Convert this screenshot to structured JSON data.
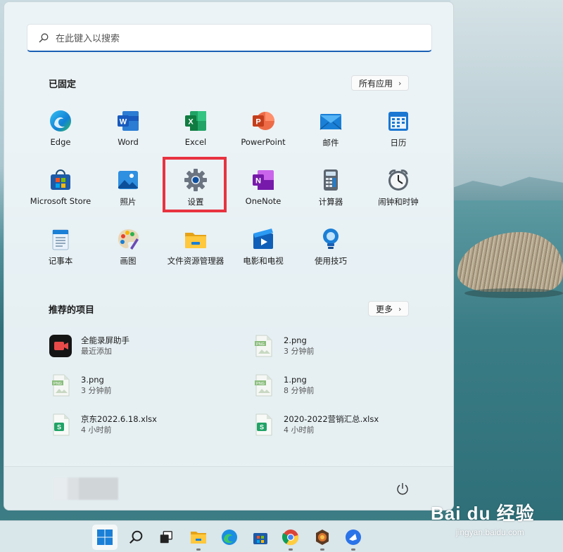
{
  "search": {
    "placeholder": "在此键入以搜索"
  },
  "pinned": {
    "title": "已固定",
    "all_apps_label": "所有应用",
    "apps": [
      {
        "label": "Edge",
        "icon": "edge-icon"
      },
      {
        "label": "Word",
        "icon": "word-icon"
      },
      {
        "label": "Excel",
        "icon": "excel-icon"
      },
      {
        "label": "PowerPoint",
        "icon": "powerpoint-icon"
      },
      {
        "label": "邮件",
        "icon": "mail-icon"
      },
      {
        "label": "日历",
        "icon": "calendar-icon"
      },
      {
        "label": "Microsoft Store",
        "icon": "store-icon"
      },
      {
        "label": "照片",
        "icon": "photos-icon"
      },
      {
        "label": "设置",
        "icon": "settings-gear-icon"
      },
      {
        "label": "OneNote",
        "icon": "onenote-icon"
      },
      {
        "label": "计算器",
        "icon": "calculator-icon"
      },
      {
        "label": "闹钟和时钟",
        "icon": "alarm-clock-icon"
      },
      {
        "label": "记事本",
        "icon": "notepad-icon"
      },
      {
        "label": "画图",
        "icon": "paint-palette-icon"
      },
      {
        "label": "文件资源管理器",
        "icon": "file-explorer-icon"
      },
      {
        "label": "电影和电视",
        "icon": "movies-tv-icon"
      },
      {
        "label": "使用技巧",
        "icon": "tips-lightbulb-icon"
      }
    ]
  },
  "recommended": {
    "title": "推荐的项目",
    "more_label": "更多",
    "items": [
      {
        "name": "全能录屏助手",
        "time": "最近添加",
        "icon": "screen-recorder-icon"
      },
      {
        "name": "2.png",
        "time": "3 分钟前",
        "icon": "png-file-icon"
      },
      {
        "name": "3.png",
        "time": "3 分钟前",
        "icon": "png-file-icon"
      },
      {
        "name": "1.png",
        "time": "8 分钟前",
        "icon": "png-file-icon"
      },
      {
        "name": "京东2022.6.18.xlsx",
        "time": "4 小时前",
        "icon": "xlsx-file-icon"
      },
      {
        "name": "2020-2022营销汇总.xlsx",
        "time": "4 小时前",
        "icon": "xlsx-file-icon"
      }
    ]
  },
  "taskbar": {
    "icons": [
      "windows-start-icon",
      "search-icon",
      "task-view-icon",
      "file-explorer-icon",
      "edge-icon",
      "store-icon",
      "chrome-icon",
      "game-app-icon",
      "feishu-icon"
    ]
  },
  "watermark": {
    "main": "Bai du 经验",
    "sub": "jingyan.baidu.com"
  },
  "colors": {
    "accent": "#1a5fb4",
    "highlight": "#e8323f"
  }
}
